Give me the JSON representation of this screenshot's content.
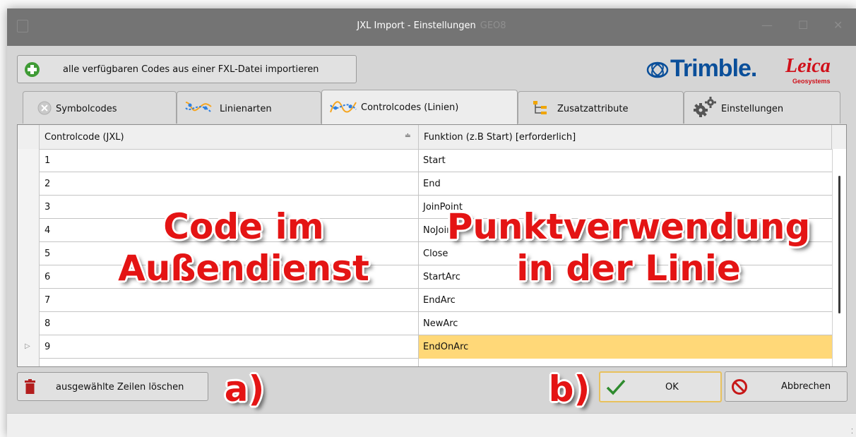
{
  "window": {
    "title": "JXL Import - Einstellungen",
    "title_faint": "GEO8",
    "controls": {
      "minimize": "—",
      "maximize": "☐",
      "close": "✕"
    }
  },
  "toolbar": {
    "import_label": "alle verfügbaren Codes aus einer FXL-Datei importieren",
    "import_icon": "plus-circle-icon"
  },
  "logos": {
    "trimble": "Trimble.",
    "leica": "Leica",
    "leica_sub": "Geosystems"
  },
  "tabs": [
    {
      "label": "Symbolcodes",
      "icon": "disabled-circle-icon"
    },
    {
      "label": "Linienarten",
      "icon": "line-style-icon"
    },
    {
      "label": "Controlcodes (Linien)",
      "icon": "control-code-line-icon",
      "active": true
    },
    {
      "label": "Zusatzattribute",
      "icon": "tree-attribute-icon"
    },
    {
      "label": "Einstellungen",
      "icon": "gears-icon"
    }
  ],
  "table": {
    "columns": [
      "Controlcode (JXL)",
      "Funktion (z.B Start) [erforderlich]"
    ],
    "sort_glyph": "≐",
    "row_marker": "▷",
    "rows": [
      {
        "code": "1",
        "func": "Start"
      },
      {
        "code": "2",
        "func": "End"
      },
      {
        "code": "3",
        "func": "JoinPoint"
      },
      {
        "code": "4",
        "func": "NoJoin"
      },
      {
        "code": "5",
        "func": "Close"
      },
      {
        "code": "6",
        "func": "StartArc"
      },
      {
        "code": "7",
        "func": "EndArc"
      },
      {
        "code": "8",
        "func": "NewArc"
      },
      {
        "code": "9",
        "func": "EndOnArc",
        "selected": true
      }
    ]
  },
  "footer": {
    "delete_label": "ausgewählte Zeilen löschen",
    "ok_label": "OK",
    "cancel_label": "Abbrechen",
    "grip": "⁚"
  },
  "annotations": {
    "left_line1": "Code im",
    "left_line2": "Außendienst",
    "right_line1": "Punktverwendung",
    "right_line2": "in der Linie",
    "a": "a)",
    "b": "b)"
  },
  "colors": {
    "titlebar": "#747474",
    "selected_cell": "#ffd878",
    "annotation": "#e41414",
    "trimble_blue": "#0a4f9a",
    "leica_red": "#d0101a"
  }
}
